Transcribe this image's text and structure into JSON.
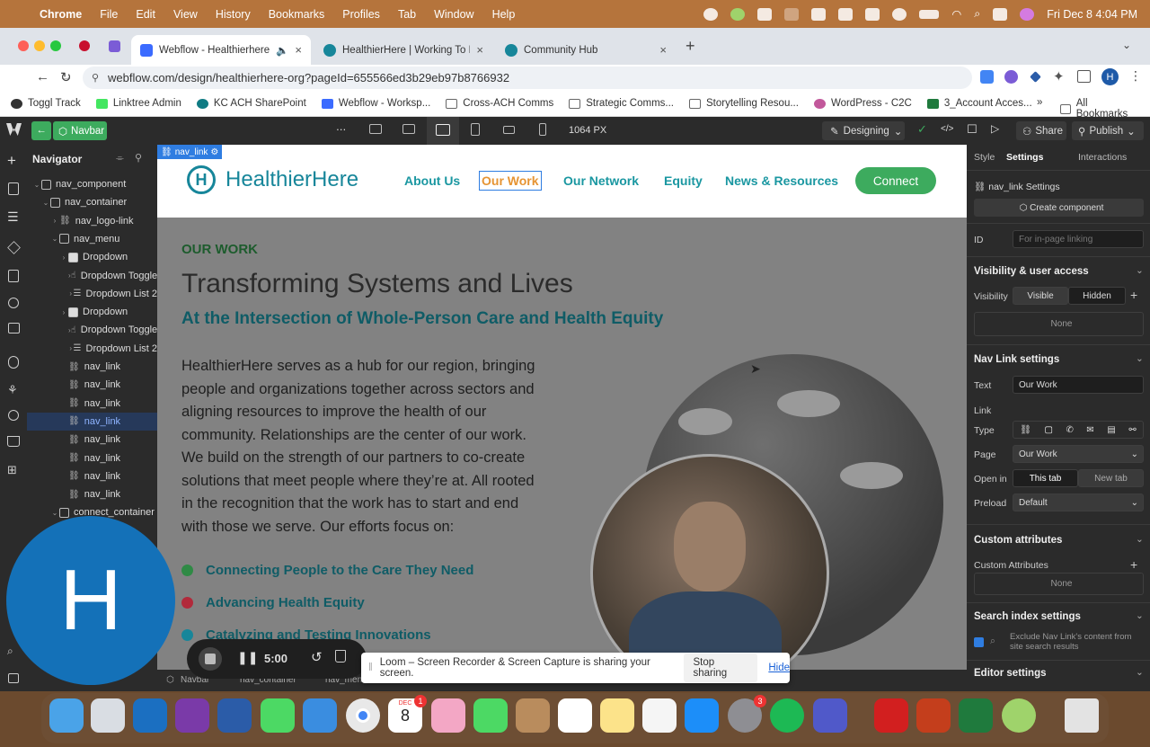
{
  "menubar": {
    "app": "Chrome",
    "items": [
      "File",
      "Edit",
      "View",
      "History",
      "Bookmarks",
      "Profiles",
      "Tab",
      "Window",
      "Help"
    ],
    "datetime": "Fri Dec 8  4:04 PM"
  },
  "tabs": [
    {
      "title": "Webflow - Healthierhere.o",
      "active": true
    },
    {
      "title": "HealthierHere | Working To M",
      "active": false
    },
    {
      "title": "Community Hub",
      "active": false
    }
  ],
  "address": {
    "url": "webflow.com/design/healthierhere-org?pageId=655566ed3b29eb97b8766932",
    "profile_initial": "H"
  },
  "bookmarks": [
    "Toggl Track",
    "Linktree Admin",
    "KC ACH SharePoint",
    "Webflow - Worksp...",
    "Cross-ACH Comms",
    "Strategic Comms...",
    "Storytelling Resou...",
    "WordPress - C2C",
    "3_Account Acces..."
  ],
  "bookmarks_more": "»",
  "all_bookmarks": "All Bookmarks",
  "wf_top": {
    "component": "Navbar",
    "width": "1064 PX",
    "mode": "Designing",
    "share": "Share",
    "publish": "Publish"
  },
  "navigator": {
    "title": "Navigator",
    "items": [
      {
        "label": "nav_component",
        "depth": 0,
        "type": "box"
      },
      {
        "label": "nav_container",
        "depth": 1,
        "type": "box"
      },
      {
        "label": "nav_logo-link",
        "depth": 2,
        "type": "link"
      },
      {
        "label": "nav_menu",
        "depth": 2,
        "type": "box"
      },
      {
        "label": "Dropdown",
        "depth": 3,
        "type": "dd"
      },
      {
        "label": "Dropdown Toggle",
        "depth": 4,
        "type": "hand"
      },
      {
        "label": "Dropdown List 2",
        "depth": 4,
        "type": "list"
      },
      {
        "label": "Dropdown",
        "depth": 3,
        "type": "dd"
      },
      {
        "label": "Dropdown Toggle",
        "depth": 4,
        "type": "hand"
      },
      {
        "label": "Dropdown List 2",
        "depth": 4,
        "type": "list"
      },
      {
        "label": "nav_link",
        "depth": 3,
        "type": "link"
      },
      {
        "label": "nav_link",
        "depth": 3,
        "type": "link"
      },
      {
        "label": "nav_link",
        "depth": 3,
        "type": "link"
      },
      {
        "label": "nav_link",
        "depth": 3,
        "type": "link",
        "selected": true
      },
      {
        "label": "nav_link",
        "depth": 3,
        "type": "link"
      },
      {
        "label": "nav_link",
        "depth": 3,
        "type": "link"
      },
      {
        "label": "nav_link",
        "depth": 3,
        "type": "link"
      },
      {
        "label": "nav_link",
        "depth": 3,
        "type": "link"
      },
      {
        "label": "connect_container",
        "depth": 2,
        "type": "box"
      },
      {
        "label": "cont",
        "depth": 2,
        "type": "box"
      }
    ]
  },
  "selected_tag": "nav_link",
  "site": {
    "logo": "HealthierHere",
    "nav": [
      "About Us",
      "Our Work",
      "Our Network",
      "Equity",
      "News & Resources"
    ],
    "connect": "Connect",
    "eyebrow": "OUR WORK",
    "heading": "Transforming Systems and Lives",
    "subheading": "At the Intersection of Whole-Person Care and Health Equity",
    "body": "HealthierHere serves as a hub for our region, bringing people and organizations together across sectors and aligning resources to improve the health of our community. Relationships are the center of our work. We build on the strength of our partners to co-create solutions that meet people where they’re at. All rooted in the recognition that the work has to start and end with those we serve. Our efforts focus on:",
    "bullets": [
      {
        "text": "Connecting People to the Care They Need",
        "color": "#2f8a45"
      },
      {
        "text": "Advancing Health Equity",
        "color": "#b22a3b"
      },
      {
        "text": "Catalyzing and Testing Innovations",
        "color": "#17869a"
      }
    ]
  },
  "right_panel": {
    "tabs": [
      "Style",
      "Settings",
      "Interactions"
    ],
    "settings_title": "nav_link Settings",
    "create_component": "Create component",
    "id_label": "ID",
    "id_placeholder": "For in-page linking",
    "visibility_title": "Visibility & user access",
    "visibility_label": "Visibility",
    "visible": "Visible",
    "hidden": "Hidden",
    "none": "None",
    "navlink_title": "Nav Link settings",
    "text_label": "Text",
    "text_value": "Our Work",
    "link_label": "Link",
    "type_label": "Type",
    "page_label": "Page",
    "page_value": "Our Work",
    "openin_label": "Open in",
    "this_tab": "This tab",
    "new_tab": "New tab",
    "preload_label": "Preload",
    "preload_value": "Default",
    "custom_attr_title": "Custom attributes",
    "custom_attr_label": "Custom Attributes",
    "custom_none": "None",
    "search_title": "Search index settings",
    "search_text": "Exclude Nav Link's content from site search results",
    "editor_title": "Editor settings"
  },
  "breadcrumbs": [
    "Navbar",
    "nav_container",
    "nav_men"
  ],
  "loom": {
    "message": "Loom – Screen Recorder & Screen Capture is sharing your screen.",
    "stop": "Stop sharing",
    "hide": "Hide",
    "timer": "5:00",
    "avatar": "H"
  },
  "dock": {
    "calendar_month": "DEC",
    "calendar_day": "8",
    "calendar_badge": "1",
    "settings_badge": "3"
  }
}
